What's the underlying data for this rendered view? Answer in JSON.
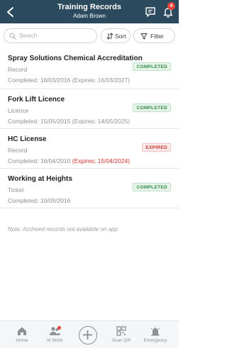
{
  "header": {
    "title": "Training Records",
    "subtitle": "Adam Brown",
    "notification_count": "4",
    "back_icon": "chevron-left-icon",
    "chat_icon": "chat-icon",
    "bell_icon": "bell-icon"
  },
  "toolbar": {
    "search_placeholder": "Search",
    "sort_label": "Sort",
    "filter_label": "Filter"
  },
  "records": [
    {
      "title": "Spray Solutions Chemical Accreditation",
      "type": "Record",
      "completed": "Completed: 18/03/2016",
      "expires": "(Expires: 16/03/2027)",
      "status": "COMPLETED"
    },
    {
      "title": "Fork Lift Licence",
      "type": "Licence",
      "completed": "Completed: 15/05/2015",
      "expires": "(Expires: 14/05/2025)",
      "status": "COMPLETED"
    },
    {
      "title": "HC License",
      "type": "Record",
      "completed": "Completed: 16/04/2010",
      "expires": "(Expires: 15/04/2024)",
      "status": "EXPIRED"
    },
    {
      "title": "Working at Heights",
      "type": "Ticket",
      "completed": "Completed: 10/09/2016",
      "expires": "",
      "status": "COMPLETED"
    }
  ],
  "note": "Note: Archived records not available on app.",
  "tabbar": {
    "home": "Home",
    "at_work": "At Work",
    "scan_qr": "Scan QR",
    "emergency": "Emergency"
  },
  "colors": {
    "header_bg": "#2c4a5e",
    "completed": "#2e8b45",
    "expired": "#d2342c",
    "badge": "#e8453c"
  }
}
